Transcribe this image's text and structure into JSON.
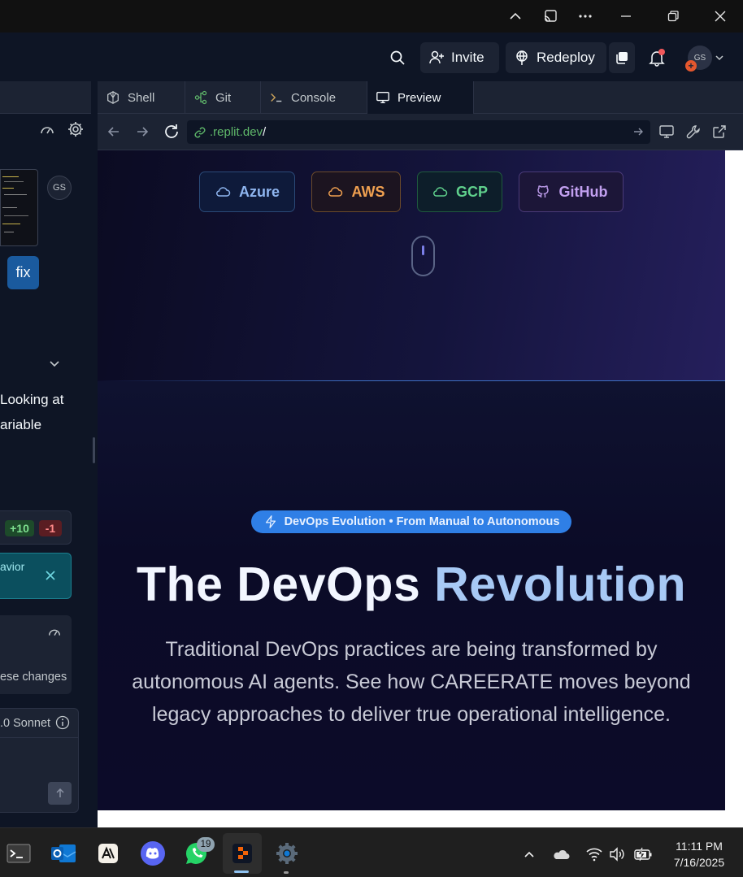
{
  "header": {
    "invite_label": "Invite",
    "redeploy_label": "Redeploy",
    "avatar_initials": "GS"
  },
  "left_panel": {
    "avatar_initials": "GS",
    "fix_label": "fix",
    "message_line1": "Looking at",
    "message_line2": "ariable",
    "diff_added": "+10",
    "diff_removed": "-1",
    "teal_text": "avior",
    "card_text": "ese changes",
    "model_label": ".0 Sonnet"
  },
  "tabs": [
    {
      "label": "Shell",
      "icon": "shell-icon"
    },
    {
      "label": "Git",
      "icon": "git-icon"
    },
    {
      "label": "Console",
      "icon": "console-icon"
    },
    {
      "label": "Preview",
      "icon": "monitor-icon"
    }
  ],
  "url": {
    "domain": ".replit.dev",
    "path": "/"
  },
  "preview": {
    "clouds": [
      {
        "label": "Azure",
        "color": "#8fb6f0",
        "border": "#2a4a78",
        "bg": "#0e1a3a"
      },
      {
        "label": "AWS",
        "color": "#f0a050",
        "border": "#6b4a2a",
        "bg": "#1c1420"
      },
      {
        "label": "GCP",
        "color": "#5fd08c",
        "border": "#1f5a3e",
        "bg": "#0d1e2a"
      },
      {
        "label": "GitHub",
        "color": "#c2a0f0",
        "border": "#4a3a78",
        "bg": "#1c1638"
      }
    ],
    "badge": "DevOps Evolution • From Manual to Autonomous",
    "headline_part1": "The DevOps",
    "headline_part2": "Revolution",
    "subtext_line1": "Traditional DevOps practices are being transformed by",
    "subtext_line2": "autonomous AI agents. See how CAREERATE moves beyond",
    "subtext_line3": "legacy approaches to deliver true operational intelligence."
  },
  "taskbar": {
    "whatsapp_badge": "19",
    "time": "11:11 PM",
    "date": "7/16/2025"
  }
}
